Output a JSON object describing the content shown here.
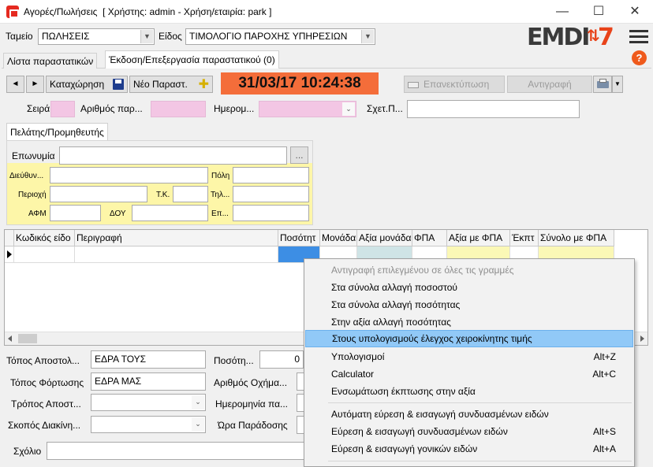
{
  "window": {
    "title": "Αγορές/Πωλήσεις  [ Χρήστης: admin - Χρήση/εταιρία: park ]",
    "minimize": "—",
    "maximize": "☐",
    "close": "✕"
  },
  "header": {
    "tameio_label": "Ταμείο",
    "tameio_value": "ΠΩΛΗΣΕΙΣ",
    "eidos_label": "Είδος",
    "eidos_value": "ΤΙΜΟΛΟΓΙΟ ΠΑΡΟΧΗΣ ΥΠΗΡΕΣΙΩΝ",
    "logo_text": "EMDI",
    "logo_suffix": "7",
    "help": "?"
  },
  "tabs": [
    {
      "label": "Λίστα παραστατικών"
    },
    {
      "label": "Έκδοση/Επεξεργασία παραστατικού (0)"
    }
  ],
  "toolbar": {
    "prev": "◄",
    "next": "►",
    "save": "Καταχώρηση",
    "new_doc": "Νέο Παραστ.",
    "datetime": "31/03/17 10:24:38",
    "reprint": "Επανεκτύπωση",
    "copy": "Αντιγραφή"
  },
  "docinfo": {
    "seira_label": "Σειρά",
    "arithmos_label": "Αριθμός παρ...",
    "hmerominia_label": "Ημερομ...",
    "sxet_label": "Σχετ.Π..."
  },
  "customer": {
    "tab_label": "Πελάτης/Προμηθευτής",
    "eponymia_label": "Επωνυμία",
    "browse": "...",
    "dieythinsi_label": "Διεύθυν...",
    "poli_label": "Πόλη",
    "perioxi_label": "Περιοχή",
    "tk_label": "Τ.Κ.",
    "til_label": "Τηλ...",
    "afm_label": "ΑΦΜ",
    "doy_label": "ΔΟΥ",
    "ep_label": "Επ..."
  },
  "grid": {
    "columns": [
      "Κωδικός είδο",
      "Περιγραφή",
      "Ποσότητ",
      "Μονάδα",
      "Αξία μονάδα",
      "ΦΠΑ",
      "Αξία με ΦΠΑ",
      "Έκπτ",
      "Σύνολο με ΦΠΑ"
    ]
  },
  "bottom": {
    "topos_apostolis_label": "Τόπος Αποστολ...",
    "topos_apostolis_value": "ΕΔΡΑ ΤΟΥΣ",
    "topos_fortosis_label": "Τόπος Φόρτωσης",
    "topos_fortosis_value": "ΕΔΡΑ ΜΑΣ",
    "tropos_label": "Τρόπος Αποστ...",
    "skopos_label": "Σκοπός Διακίνη...",
    "posotita_label": "Ποσότη...",
    "posotita_value": "0",
    "arithmos_oximatos_label": "Αριθμός Οχήμα...",
    "hmerominia_label": "Ημερομηνία πα...",
    "ora_label": "Ώρα Παράδοσης",
    "sxolio_label": "Σχόλιο"
  },
  "context_menu": [
    {
      "label": "Αντιγραφή επιλεγμένου σε όλες τις γραμμές",
      "shortcut": "",
      "disabled": true
    },
    {
      "label": "Στα σύνολα αλλαγή ποσοστού",
      "shortcut": ""
    },
    {
      "label": "Στα σύνολα αλλαγή ποσότητας",
      "shortcut": ""
    },
    {
      "label": "Στην αξία αλλαγή ποσότητας",
      "shortcut": ""
    },
    {
      "label": "Στους υπολογισμούς έλεγχος χειροκίνητης τιμής",
      "shortcut": "",
      "highlighted": true
    },
    {
      "label": "Υπολογισμοί",
      "shortcut": "Alt+Z"
    },
    {
      "label": "Calculator",
      "shortcut": "Alt+C"
    },
    {
      "label": "Ενσωμάτωση έκπτωσης στην αξία",
      "shortcut": ""
    },
    {
      "label": "Αυτόματη εύρεση & εισαγωγή συνδυασμένων ειδών",
      "shortcut": ""
    },
    {
      "label": "Εύρεση & εισαγωγή συνδυασμένων ειδών",
      "shortcut": "Alt+S"
    },
    {
      "label": "Εύρεση & εισαγωγή γονικών ειδών",
      "shortcut": "Alt+A"
    }
  ],
  "colors": {
    "datetime_bg": "#f46d3a",
    "pink_field": "#f3c6e4",
    "yellow_panel": "#fdf6a8",
    "menu_highlight": "#91c9f7",
    "logo_dark": "#3a3a3a",
    "logo_red": "#e8431a"
  }
}
